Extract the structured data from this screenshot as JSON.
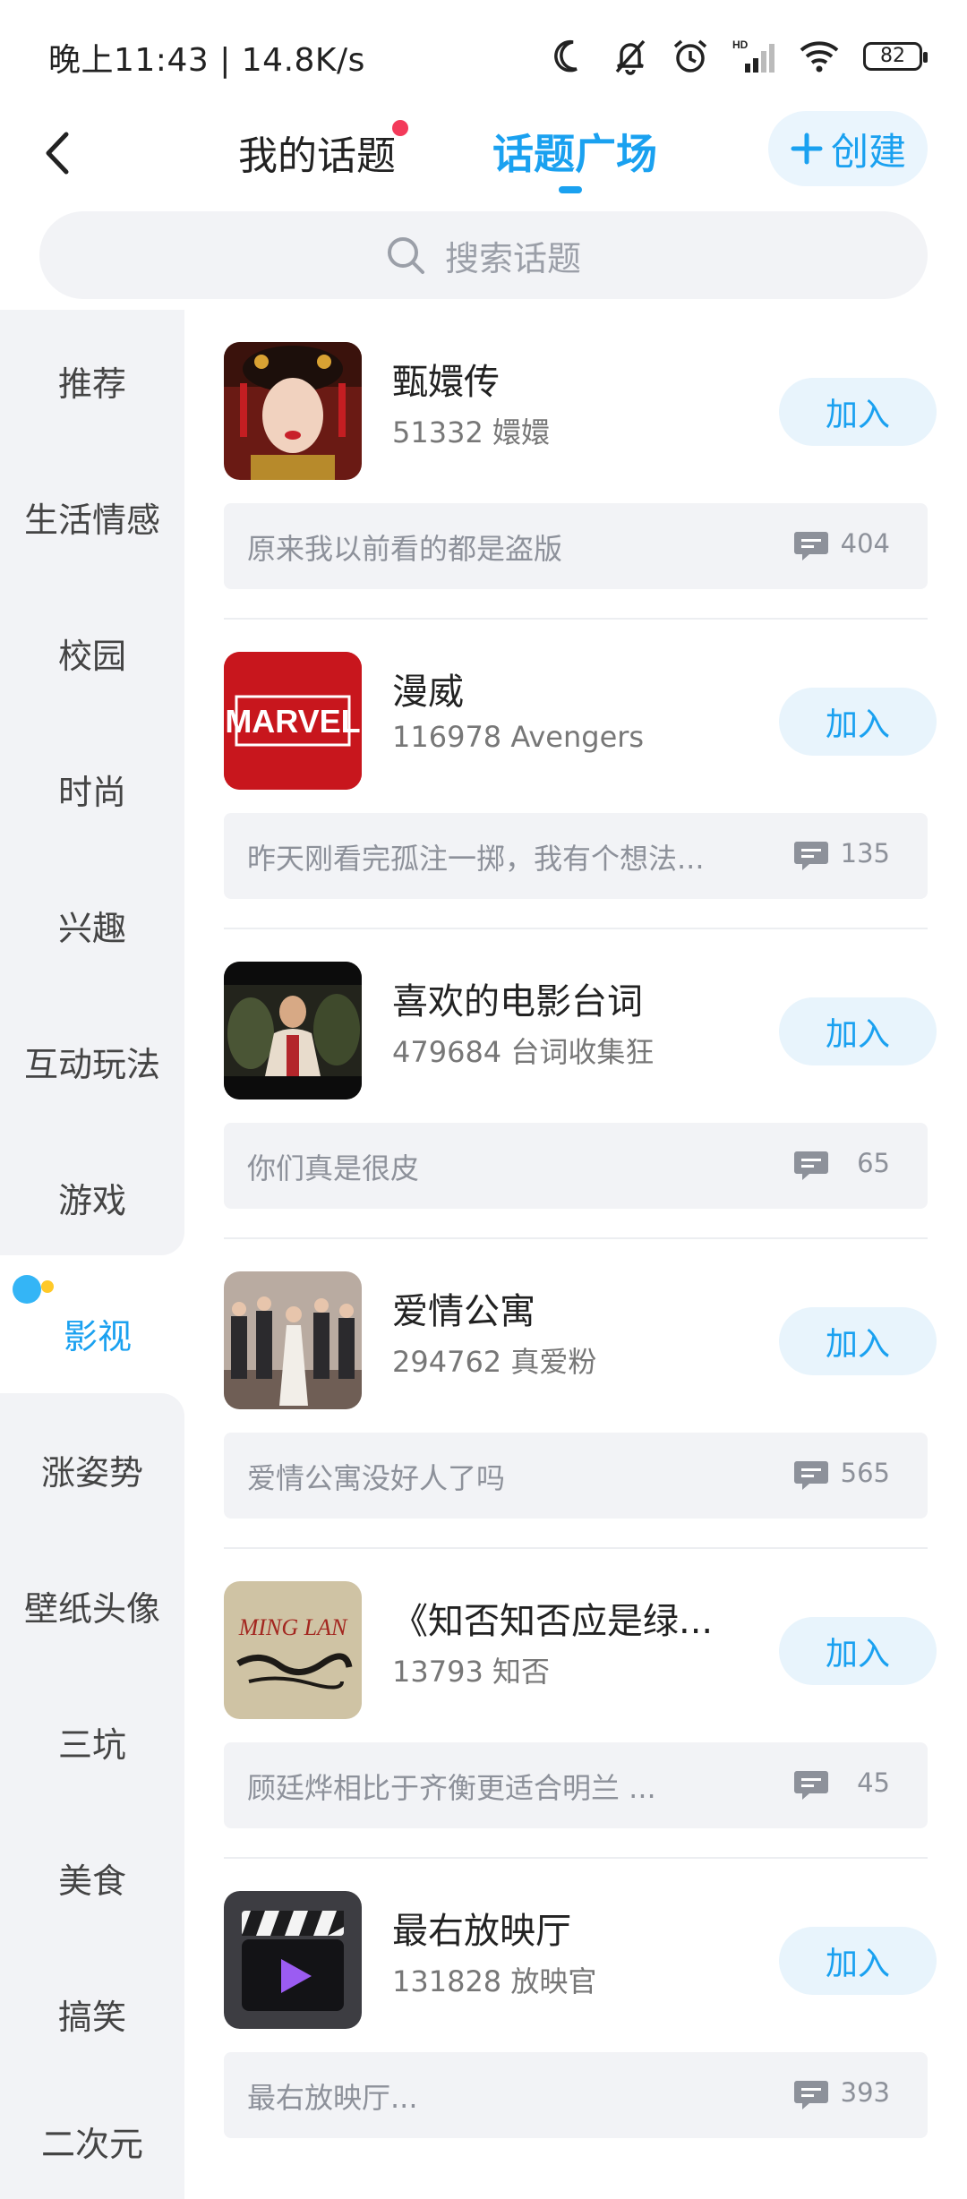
{
  "status_bar": {
    "time_speed": "晚上11:43 | 14.8K/s",
    "battery": "82",
    "network_label": "HD"
  },
  "header": {
    "tab_mine": "我的话题",
    "tab_square": "话题广场",
    "create_label": "创建"
  },
  "search": {
    "placeholder": "搜索话题"
  },
  "sidebar": {
    "items": [
      "推荐",
      "生活情感",
      "校园",
      "时尚",
      "兴趣",
      "互动玩法",
      "游戏",
      "影视",
      "涨姿势",
      "壁纸头像",
      "三坑",
      "美食",
      "搞笑",
      "二次元"
    ],
    "active": "影视"
  },
  "topics": [
    {
      "name": "甄嬛传",
      "count": "51332",
      "fans": "嬛嬛",
      "join": "加入",
      "preview": "原来我以前看的都是盗版",
      "comments": "404",
      "thumb": "portrait-photo"
    },
    {
      "name": "漫威",
      "count": "116978",
      "fans": "Avengers",
      "join": "加入",
      "preview": "昨天刚看完孤注一掷，我有个想法...",
      "comments": "135",
      "thumb_text": "MARVEL"
    },
    {
      "name": "喜欢的电影台词",
      "count": "479684",
      "fans": "台词收集狂",
      "join": "加入",
      "preview": "你们真是很皮",
      "comments": "65",
      "thumb": "movie-still"
    },
    {
      "name": "爱情公寓",
      "count": "294762",
      "fans": "真爱粉",
      "join": "加入",
      "preview": "爱情公寓没好人了吗",
      "comments": "565",
      "thumb": "group-photo"
    },
    {
      "name": "《知否知否应是绿...",
      "count": "13793",
      "fans": "知否",
      "join": "加入",
      "preview": "顾廷烨相比于齐衡更适合明兰 ...",
      "comments": "45",
      "thumb_text": "MING LAN"
    },
    {
      "name": "最右放映厅",
      "count": "131828",
      "fans": "放映官",
      "join": "加入",
      "preview": "最右放映厅...",
      "comments": "393",
      "thumb": "clapperboard-icon"
    }
  ],
  "colors": {
    "accent": "#1aa1f0",
    "badge": "#f33a5a",
    "panel": "#f2f3f6"
  }
}
